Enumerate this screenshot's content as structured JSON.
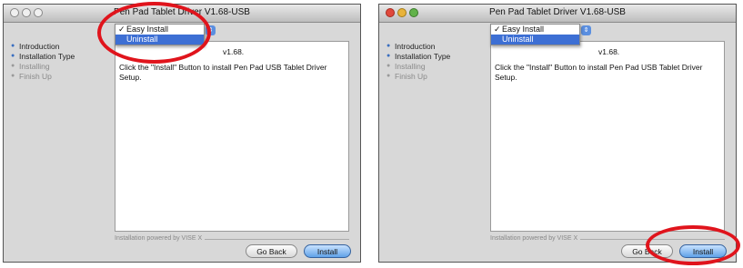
{
  "windows": [
    {
      "title": "Pen Pad Tablet Driver V1.68-USB",
      "menu": {
        "items": [
          {
            "label": "Easy Install",
            "checked": true
          },
          {
            "label": "Uninstall",
            "checked": false
          }
        ]
      },
      "partial_text": "v1.68.",
      "steps": [
        {
          "label": "Introduction",
          "state": "done"
        },
        {
          "label": "Installation Type",
          "state": "current"
        },
        {
          "label": "Installing",
          "state": "pending"
        },
        {
          "label": "Finish Up",
          "state": "pending"
        }
      ],
      "body": "Click the \"Install\" Button to install Pen Pad USB Tablet Driver Setup.",
      "powered": "Installation powered by VISE X",
      "back_label": "Go Back",
      "install_label": "Install"
    },
    {
      "title": "Pen Pad Tablet Driver V1.68-USB",
      "menu": {
        "items": [
          {
            "label": "Easy Install",
            "checked": true
          },
          {
            "label": "Uninstall",
            "checked": false
          }
        ]
      },
      "partial_text": "v1.68.",
      "steps": [
        {
          "label": "Introduction",
          "state": "done"
        },
        {
          "label": "Installation Type",
          "state": "current"
        },
        {
          "label": "Installing",
          "state": "pending"
        },
        {
          "label": "Finish Up",
          "state": "pending"
        }
      ],
      "body": "Click the \"Install\" Button to install Pen Pad USB Tablet Driver Setup.",
      "powered": "Installation powered by VISE X",
      "back_label": "Go Back",
      "install_label": "Install"
    }
  ],
  "annotation_color": "#e0141c",
  "accent_color": "#3d6fd4"
}
